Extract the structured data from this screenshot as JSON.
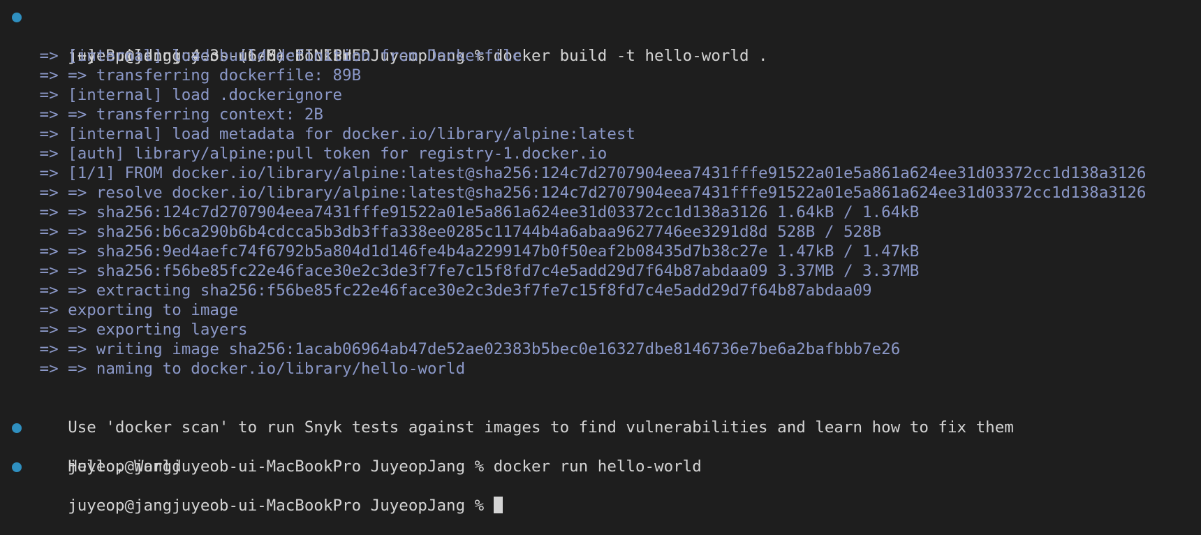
{
  "colors": {
    "background": "#1e1e1e",
    "text": "#d4d4d4",
    "build_step": "#8b98c8",
    "prompt_dot": "#2f8fbf"
  },
  "session": {
    "prompt_1": "juyeop@jangjuyeob-ui-MacBookPro JuyeopJang % docker build -t hello-world .",
    "build_header": "[+] Building 4.3s (6/6) FINISHED",
    "build_steps": [
      " => [internal] load build definition from Dockerfile",
      " => => transferring dockerfile: 89B",
      " => [internal] load .dockerignore",
      " => => transferring context: 2B",
      " => [internal] load metadata for docker.io/library/alpine:latest",
      " => [auth] library/alpine:pull token for registry-1.docker.io",
      " => [1/1] FROM docker.io/library/alpine:latest@sha256:124c7d2707904eea7431fffe91522a01e5a861a624ee31d03372cc1d138a3126",
      " => => resolve docker.io/library/alpine:latest@sha256:124c7d2707904eea7431fffe91522a01e5a861a624ee31d03372cc1d138a3126",
      " => => sha256:124c7d2707904eea7431fffe91522a01e5a861a624ee31d03372cc1d138a3126 1.64kB / 1.64kB",
      " => => sha256:b6ca290b6b4cdcca5b3db3ffa338ee0285c11744b4a6abaa9627746ee3291d8d 528B / 528B",
      " => => sha256:9ed4aefc74f6792b5a804d1d146fe4b4a2299147b0f50eaf2b08435d7b38c27e 1.47kB / 1.47kB",
      " => => sha256:f56be85fc22e46face30e2c3de3f7fe7c15f8fd7c4e5add29d7f64b87abdaa09 3.37MB / 3.37MB",
      " => => extracting sha256:f56be85fc22e46face30e2c3de3f7fe7c15f8fd7c4e5add29d7f64b87abdaa09",
      " => exporting to image",
      " => => exporting layers",
      " => => writing image sha256:1acab06964ab47de52ae02383b5bec0e16327dbe8146736e7be6a2bafbbb7e26",
      " => => naming to docker.io/library/hello-world"
    ],
    "scan_hint": "Use 'docker scan' to run Snyk tests against images to find vulnerabilities and learn how to fix them",
    "prompt_2": "juyeop@jangjuyeob-ui-MacBookPro JuyeopJang % docker run hello-world",
    "run_output": "Hello, World",
    "prompt_3": "juyeop@jangjuyeob-ui-MacBookPro JuyeopJang % "
  }
}
